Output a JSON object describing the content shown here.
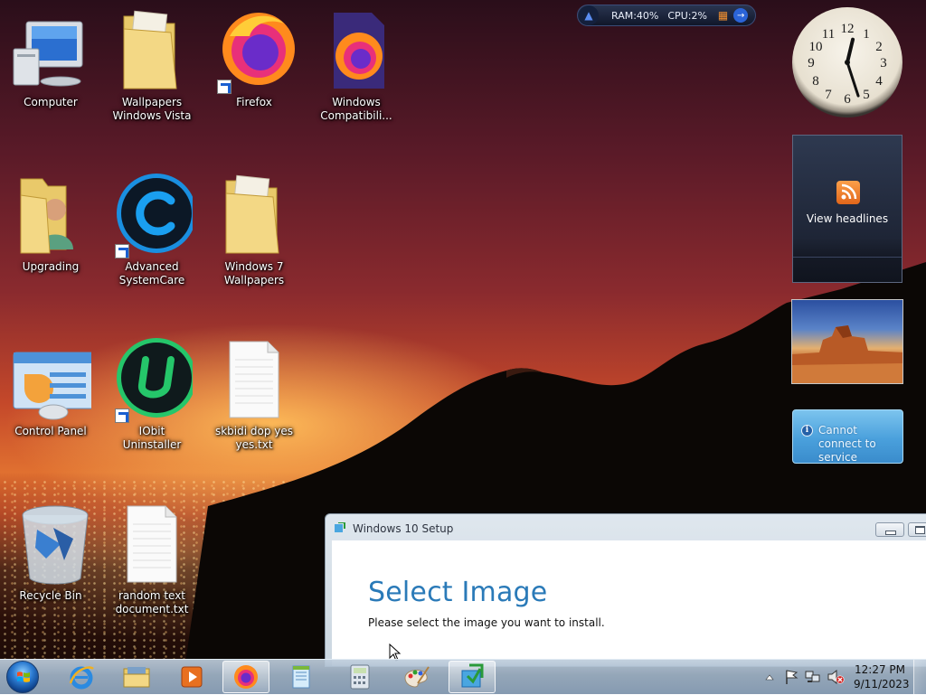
{
  "desktop": {
    "icons": [
      {
        "label": "Computer",
        "icon": "computer-icon",
        "shortcut": false
      },
      {
        "label": "Wallpapers Windows Vista",
        "icon": "folder-icon",
        "shortcut": false
      },
      {
        "label": "Firefox",
        "icon": "firefox-icon",
        "shortcut": true
      },
      {
        "label": "Windows Compatibili...",
        "icon": "firefox-icon",
        "shortcut": false
      },
      {
        "label": "Upgrading",
        "icon": "user-folder-icon",
        "shortcut": false
      },
      {
        "label": "Advanced SystemCare",
        "icon": "advanced-systemcare-icon",
        "shortcut": true
      },
      {
        "label": "Windows 7 Wallpapers",
        "icon": "folder-icon",
        "shortcut": false
      },
      {
        "label": "Control Panel",
        "icon": "control-panel-icon",
        "shortcut": false
      },
      {
        "label": "IObit Uninstaller",
        "icon": "iobit-uninstaller-icon",
        "shortcut": true
      },
      {
        "label": "skbidi dop yes yes.txt",
        "icon": "text-document-icon",
        "shortcut": false
      },
      {
        "label": "Recycle Bin",
        "icon": "recycle-bin-icon",
        "shortcut": false
      },
      {
        "label": "random text document.txt",
        "icon": "text-document-icon",
        "shortcut": false
      }
    ]
  },
  "resource_widget": {
    "ram": "RAM:40%",
    "cpu": "CPU:2%",
    "icons": [
      "rocket-icon",
      "gift-icon",
      "arrow-right-icon"
    ]
  },
  "gadgets": {
    "clock": {
      "time": "12:27",
      "numerals": [
        "12",
        "1",
        "2",
        "3",
        "4",
        "5",
        "6",
        "7",
        "8",
        "9",
        "10",
        "11"
      ]
    },
    "feed": {
      "label": "View headlines",
      "icon": "rss-icon"
    },
    "slideshow": {
      "icon": "photo-icon"
    },
    "weather": {
      "message": "Cannot connect to service",
      "icon": "info-icon"
    }
  },
  "setup_window": {
    "title": "Windows 10 Setup",
    "heading": "Select Image",
    "subtext": "Please select the image you want to install."
  },
  "taskbar": {
    "pinned": [
      {
        "name": "internet-explorer-icon",
        "active": false
      },
      {
        "name": "file-explorer-icon",
        "active": false
      },
      {
        "name": "media-player-icon",
        "active": false
      },
      {
        "name": "firefox-icon",
        "active": true
      },
      {
        "name": "notepad-icon",
        "active": false
      },
      {
        "name": "calculator-icon",
        "active": false
      },
      {
        "name": "paint-icon",
        "active": false
      },
      {
        "name": "windows-setup-icon",
        "active": true
      }
    ],
    "tray_icons": [
      "show-hidden-icons-arrow",
      "action-center-flag-icon",
      "network-icon",
      "volume-muted-icon"
    ],
    "time": "12:27 PM",
    "date": "9/11/2023"
  },
  "colors": {
    "heading_blue": "#2a7ab8",
    "window_border": "#8b9aa9",
    "weather_blue": "#4aa0dc"
  }
}
